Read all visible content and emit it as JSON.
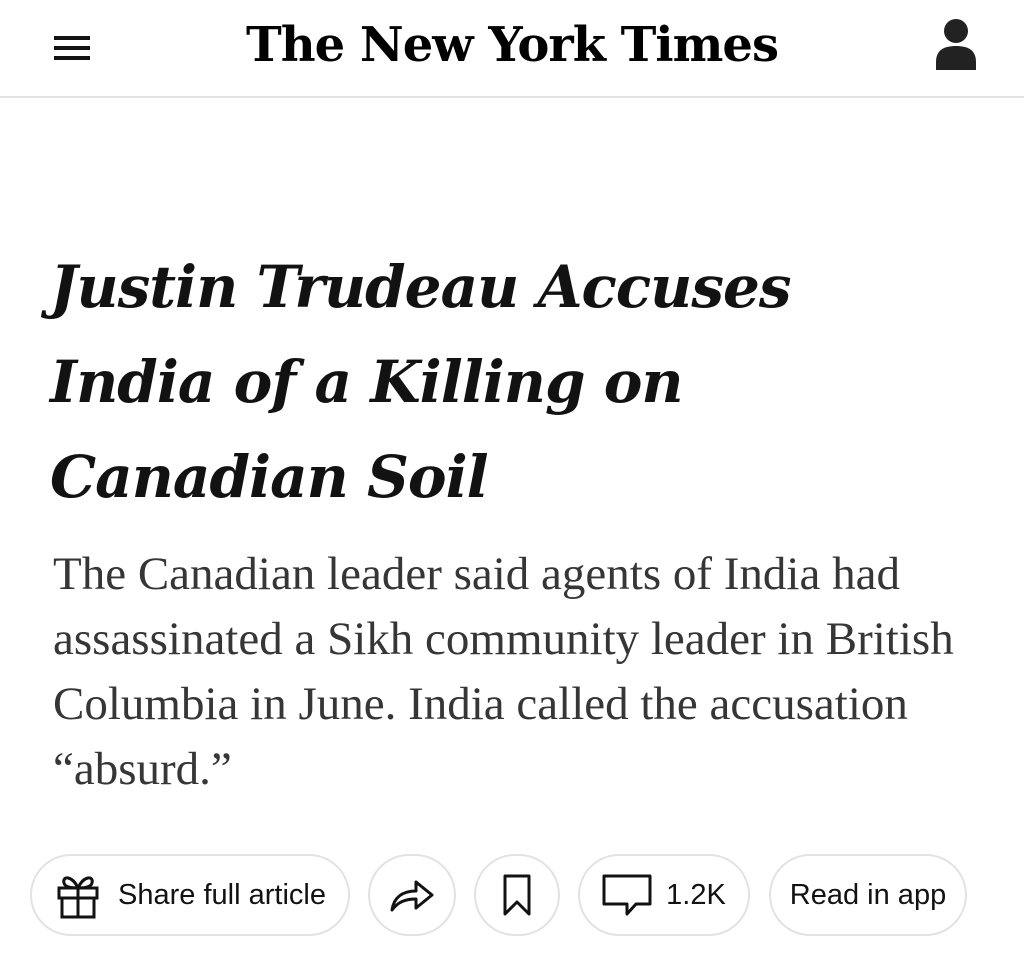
{
  "header": {
    "masthead": "The New York Times",
    "menu_icon": "hamburger-menu-icon",
    "account_icon": "person-icon"
  },
  "article": {
    "headline": "Justin Trudeau Accuses India of a Killing on Canadian Soil",
    "summary": "The Canadian leader said agents of India had assassinated a Sikh community leader in British Columbia in June. India called the accusation “absurd.”"
  },
  "actions": {
    "share_full_label": "Share full article",
    "share_icon": "gift-icon",
    "share_arrow_icon": "share-arrow-icon",
    "save_icon": "bookmark-icon",
    "comments_icon": "comment-icon",
    "comments_count": "1.2K",
    "read_in_app_label": "Read in app"
  },
  "colors": {
    "text": "#121212",
    "summary_text": "#363636",
    "border": "#e2e2e2",
    "background": "#ffffff"
  }
}
